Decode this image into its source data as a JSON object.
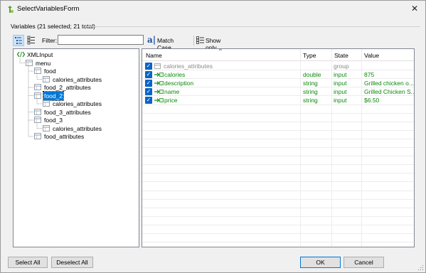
{
  "window": {
    "title": "SelectVariablesForm",
    "close_glyph": "✕"
  },
  "group": {
    "label": "Variables (21 selected; 21 total)"
  },
  "toolbar": {
    "filter_label": "Filter:",
    "filter_value": "",
    "match_case_label": "Match Case",
    "show_selected_label": "Show only selected variables"
  },
  "tree": [
    {
      "label": "XMLInput",
      "icon": "xml-icon",
      "depth": 0,
      "selected": false
    },
    {
      "label": "menu",
      "icon": "table-icon",
      "depth": 1,
      "selected": false
    },
    {
      "label": "food",
      "icon": "table-icon",
      "depth": 2,
      "selected": false
    },
    {
      "label": "calories_attributes",
      "icon": "table-icon",
      "depth": 3,
      "selected": false
    },
    {
      "label": "food_2_attributes",
      "icon": "table-icon",
      "depth": 2,
      "selected": false
    },
    {
      "label": "food_2",
      "icon": "table-icon",
      "depth": 2,
      "selected": true
    },
    {
      "label": "calories_attributes",
      "icon": "table-icon",
      "depth": 3,
      "selected": false
    },
    {
      "label": "food_3_attributes",
      "icon": "table-icon",
      "depth": 2,
      "selected": false
    },
    {
      "label": "food_3",
      "icon": "table-icon",
      "depth": 2,
      "selected": false
    },
    {
      "label": "calories_attributes",
      "icon": "table-icon",
      "depth": 3,
      "selected": false
    },
    {
      "label": "food_attributes",
      "icon": "table-icon",
      "depth": 2,
      "selected": false
    }
  ],
  "grid": {
    "columns": [
      "Name",
      "Type",
      "State",
      "Value"
    ],
    "sort_glyph": "^",
    "rows": [
      {
        "name": "calories_attributes",
        "type": "",
        "state": "group",
        "value": "",
        "kind": "group",
        "checked": true
      },
      {
        "name": "calories",
        "type": "double",
        "state": "input",
        "value": "875",
        "kind": "input",
        "checked": true
      },
      {
        "name": "description",
        "type": "string",
        "state": "input",
        "value": "Grilled chicken o...",
        "kind": "input",
        "checked": true
      },
      {
        "name": "name",
        "type": "string",
        "state": "input",
        "value": "Grilled Chicken S...",
        "kind": "input",
        "checked": true
      },
      {
        "name": "price",
        "type": "string",
        "state": "input",
        "value": "$6.50",
        "kind": "input",
        "checked": true
      }
    ]
  },
  "buttons": {
    "select_all": "Select All",
    "deselect_all": "Deselect All",
    "ok": "OK",
    "cancel": "Cancel"
  },
  "colors": {
    "accent": "#0078d7",
    "input_text": "#0a8a0a",
    "group_text": "#8a8a8a",
    "checkbox": "#0a64c8"
  }
}
